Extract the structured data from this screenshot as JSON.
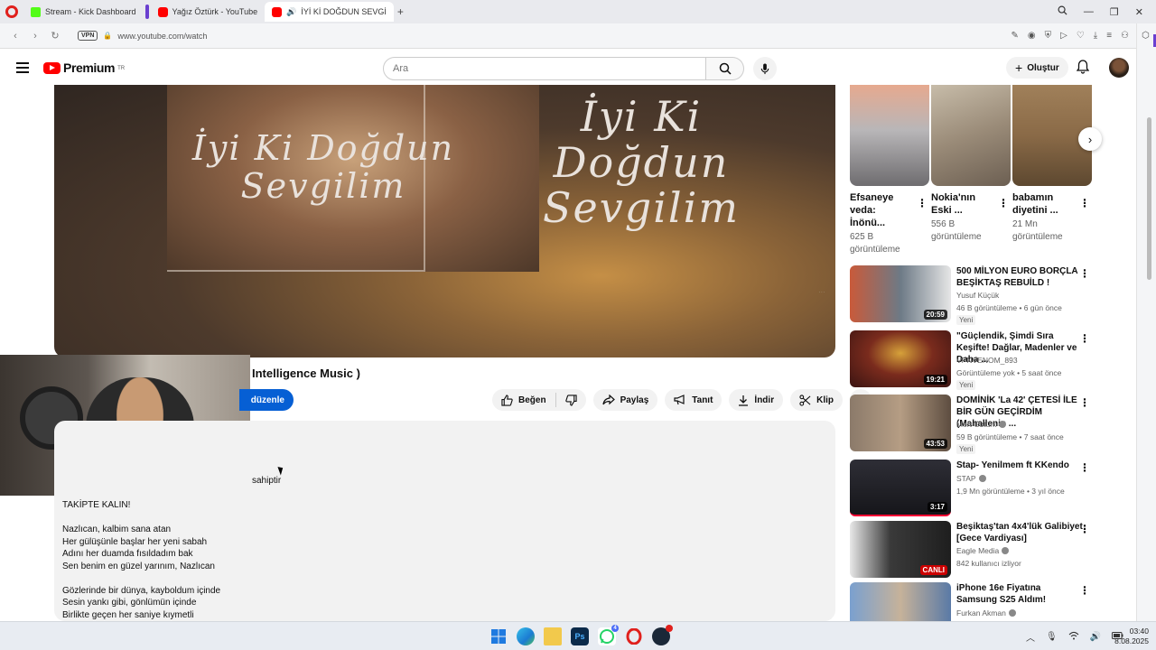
{
  "browser": {
    "tabs": [
      {
        "label": "Stream - Kick Dashboard"
      },
      {
        "label": "Yağız Öztürk - YouTube"
      },
      {
        "label": "İYİ Kİ DOĞDUN SEVGİ"
      }
    ],
    "url": "www.youtube.com/watch",
    "vpn_label": "VPN"
  },
  "header": {
    "logo_text": "Premium",
    "region": "TR",
    "search_placeholder": "Ara",
    "create_label": "Oluştur"
  },
  "video": {
    "overlay_left": "İyi Ki Doğdun\nSevgilim",
    "overlay_right": "İyi Ki Doğdun\nSevgilim",
    "title_fragment": "Intelligence Music )",
    "edit_label": "düzenle"
  },
  "actions": {
    "like": "Beğen",
    "share": "Paylaş",
    "promote": "Tanıt",
    "download": "İndir",
    "clip": "Klip"
  },
  "description": {
    "fragment": "sahiptir",
    "text": "TAKİPTE KALIN!\n\nNazlıcan, kalbim sana atan\nHer gülüşünle başlar her yeni sabah\nAdını her duamda fısıldadım bak\nSen benim en güzel yarınım, Nazlıcan\n\nGözlerinde bir dünya, kayboldum içinde\nSesin yankı gibi, gönlümün içinde\nBirlikte geçen her saniye kıymetli"
  },
  "shorts": [
    {
      "title": "Efsaneye veda: İnönü...",
      "views": "625 B görüntüleme",
      "color": "#c9876f"
    },
    {
      "title": "Nokia'nın Eski ...",
      "views": "556 B görüntüleme",
      "color": "#9a8b78"
    },
    {
      "title": "babamın diyetini ...",
      "views": "21 Mn görüntüleme",
      "color": "#8a6a47"
    }
  ],
  "recommendations": [
    {
      "title": "500 MİLYON EURO BORÇLA BEŞİKTAŞ REBUİLD !",
      "channel": "Yusuf Küçük",
      "meta": "46 B görüntüleme • 6 gün önce",
      "badge": "Yeni",
      "duration": "20:59",
      "verified": false,
      "color": "#4a5b6a"
    },
    {
      "title": "\"Güçlendik, Şimdi Sıra Keşifte! Dağlar, Madenler ve Daha ...",
      "channel": "VPNVENOM_893",
      "meta": "Görüntüleme yok • 5 saat önce",
      "badge": "Yeni",
      "duration": "19:21",
      "verified": false,
      "color": "#5c1f1f"
    },
    {
      "title": "DOMİNİK 'La 42' ÇETESİ İLE BİR GÜN GEÇİRDİM (Mahallenin ...",
      "channel": "Mert Öztürk",
      "meta": "59 B görüntüleme • 7 saat önce",
      "badge": "Yeni",
      "duration": "43:53",
      "verified": true,
      "color": "#6b5a48"
    },
    {
      "title": "Stap- Yenilmem ft KKendo",
      "channel": "STAP",
      "meta": "1,9 Mn görüntüleme • 3 yıl önce",
      "badge": "",
      "duration": "3:17",
      "verified": true,
      "color": "#1e1e22"
    },
    {
      "title": "Beşiktaş'tan 4x4'lük Galibiyet [Gece Vardiyası]",
      "channel": "Eagle Media",
      "meta": "842 kullanıcı izliyor",
      "badge": "",
      "duration": "CANLI",
      "verified": true,
      "color": "#3a3a3a"
    },
    {
      "title": "iPhone 16e Fiyatına Samsung S25 Aldım!",
      "channel": "Furkan Akman",
      "meta": "",
      "badge": "",
      "duration": "",
      "verified": true,
      "color": "#5a7aa6"
    }
  ],
  "taskbar": {
    "whatsapp_count": "4",
    "time": "03:40",
    "date": "8.08.2025"
  }
}
